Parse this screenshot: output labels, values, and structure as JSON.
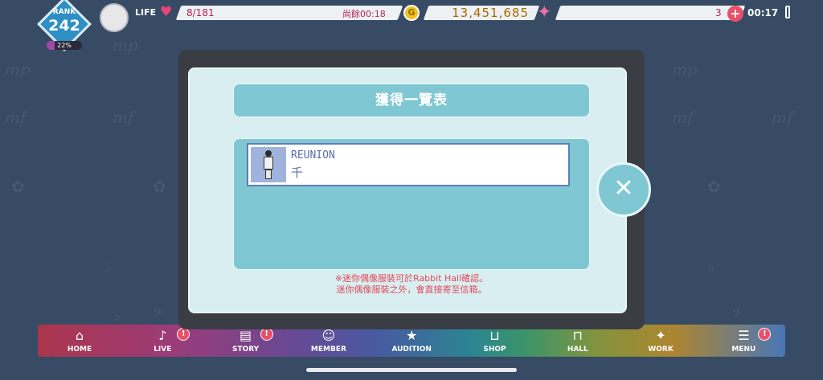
{
  "status": {
    "rank_label": "RANK",
    "rank_value": "242",
    "rank_progress_text": "22%",
    "rank_progress": 0.22,
    "life_label": "LIFE",
    "life_value": "8/181",
    "life_timer": "尚餘00:18",
    "coin_symbol": "G",
    "money": "13,451,685",
    "gems": "3",
    "plus": "+",
    "clock": "00:17"
  },
  "modal": {
    "title": "獲得一覽表",
    "items": [
      {
        "title": "REUNION",
        "subtitle": "千"
      }
    ],
    "note_line1": "※迷你偶像服裝可於Rabbit Hall確認。",
    "note_line2": "迷你偶像服裝之外，會直接寄至信箱。",
    "close_symbol": "✕"
  },
  "nav": [
    {
      "label": "HOME",
      "icon": "home-icon",
      "glyph": "⌂",
      "badge": ""
    },
    {
      "label": "LIVE",
      "icon": "music-note-icon",
      "glyph": "♪",
      "badge": "!"
    },
    {
      "label": "STORY",
      "icon": "book-icon",
      "glyph": "▤",
      "badge": "!"
    },
    {
      "label": "MEMBER",
      "icon": "member-icon",
      "glyph": "☺",
      "badge": ""
    },
    {
      "label": "AUDITION",
      "icon": "audition-icon",
      "glyph": "★",
      "badge": ""
    },
    {
      "label": "SHOP",
      "icon": "basket-icon",
      "glyph": "⊔",
      "badge": ""
    },
    {
      "label": "HALL",
      "icon": "hall-icon",
      "glyph": "⊓",
      "badge": ""
    },
    {
      "label": "WORK",
      "icon": "work-icon",
      "glyph": "✦",
      "badge": ""
    },
    {
      "label": "MENU",
      "icon": "menu-icon",
      "glyph": "☰",
      "badge": "!"
    }
  ],
  "colors": {
    "accent": "#7fc8d3",
    "note": "#e24a5a",
    "heart": "#e9457a",
    "coin": "#f3c21f"
  }
}
